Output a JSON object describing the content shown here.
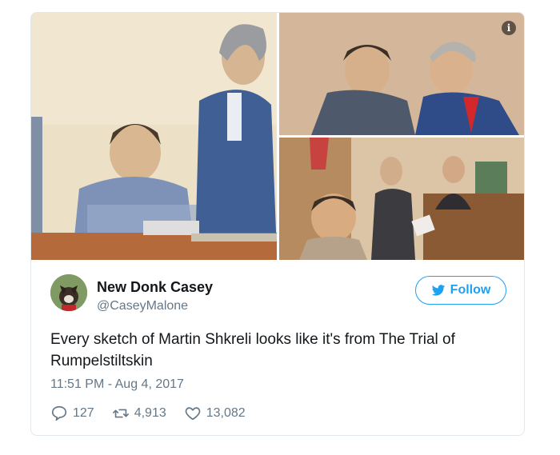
{
  "tweet": {
    "author_name": "New Donk Casey",
    "handle": "@CaseyMalone",
    "follow_label": "Follow",
    "text": "Every sketch of Martin Shkreli looks like it's from The Trial of Rumpelstiltskin",
    "timestamp": "11:51 PM - Aug 4, 2017",
    "replies": "127",
    "retweets": "4,913",
    "likes": "13,082"
  },
  "media": {
    "info_glyph": "i",
    "icons": [
      "info-icon"
    ]
  },
  "colors": {
    "accent": "#1da1f2",
    "secondary_text": "#657786",
    "border": "#e1e8ed"
  }
}
